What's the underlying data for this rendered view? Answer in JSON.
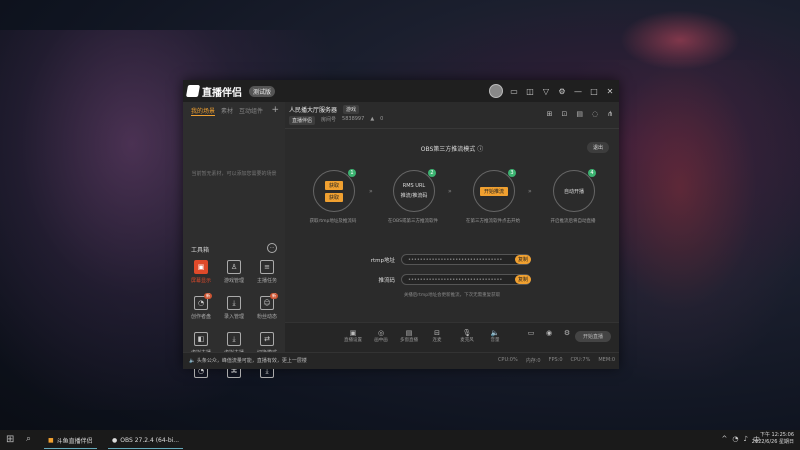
{
  "app": {
    "name": "直播伴侣",
    "version_badge": "测试版"
  },
  "left_panel": {
    "tabs": [
      "我的场景",
      "素材",
      "互动组件"
    ],
    "empty_message": "当前暂无素材，可以添加您需要的场景",
    "tools_title": "工具箱",
    "tools": [
      {
        "label": "屏幕显示",
        "icon": "monitor-icon",
        "selected": true
      },
      {
        "label": "游戏管理",
        "icon": "person-icon"
      },
      {
        "label": "主播任务",
        "icon": "list-icon"
      },
      {
        "label": "创作者盘",
        "icon": "chart-icon",
        "badge": "新"
      },
      {
        "label": "录入管理",
        "icon": "download-icon"
      },
      {
        "label": "粉丝动态",
        "icon": "fans-icon",
        "badge": "新"
      },
      {
        "label": "虚拟主播",
        "icon": "avatar-icon"
      },
      {
        "label": "虚拟主播",
        "icon": "download-icon"
      },
      {
        "label": "切换模式",
        "icon": "switch-icon"
      },
      {
        "label": "",
        "icon": "chart-icon"
      },
      {
        "label": "",
        "icon": "cast-icon",
        "badge": "新"
      },
      {
        "label": "",
        "icon": "download-icon"
      }
    ]
  },
  "room": {
    "title": "人民播大厅服务器",
    "tag": "游戏",
    "sub_pill": "直播伴侣",
    "room_id_label": "房间号",
    "room_id": "5838997",
    "hot": "0"
  },
  "obs": {
    "title": "OBS第三方推流模式",
    "exit": "退出",
    "steps": [
      {
        "num": "1",
        "lines": [
          "获取",
          "获取"
        ],
        "desc": "获取rtmp地址及推流码"
      },
      {
        "num": "2",
        "lines": [
          "RMS URL",
          "推流/推流码"
        ],
        "desc": "在OBS或第三方推流软件"
      },
      {
        "num": "3",
        "lines": [
          "开始推流"
        ],
        "desc": "在第三方推流软件点击开始"
      },
      {
        "num": "4",
        "lines": [
          "自动开播"
        ],
        "desc": "开启推流后将自动直播"
      }
    ],
    "fields": [
      {
        "label": "rtmp地址",
        "value": "••••••••••••••••••••••••••••••••",
        "button": "复制"
      },
      {
        "label": "推流码",
        "value": "••••••••••••••••••••••••••••••••",
        "button": "复制"
      }
    ],
    "hint": "关播后rtmp地址会更新推流，下次无需重复获取"
  },
  "bottom_toolbar": {
    "buttons": [
      "直播设置",
      "画中画",
      "多窗直播",
      "连麦",
      "麦克风",
      "音量"
    ],
    "live_button": "开始直播"
  },
  "notice": "头条公众，峰值流量可能，直播有效，更上一层楼",
  "status": [
    "CPU:0%",
    "内存:0",
    "FPS:0",
    "CPU:7%",
    "MEM:0"
  ],
  "taskbar": {
    "tasks": [
      "斗鱼直播伴侣",
      "OBS 27.2.4 (64-bi..."
    ],
    "time": "下午 12:25:06",
    "date": "2022/6/26 星期日"
  }
}
